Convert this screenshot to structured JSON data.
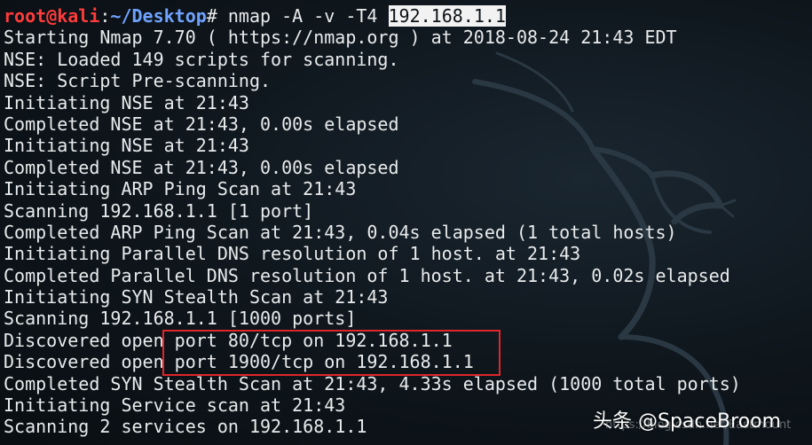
{
  "prompt": {
    "user_host": "root@kali",
    "separator": ":",
    "path": "~/Desktop",
    "symbol": "# ",
    "command": "nmap -A -v -T4 ",
    "target": "192.168.1.1"
  },
  "previous_line": "'' ' '  '  '",
  "output": [
    "Starting Nmap 7.70 ( https://nmap.org ) at 2018-08-24 21:43 EDT",
    "NSE: Loaded 149 scripts for scanning.",
    "NSE: Script Pre-scanning.",
    "Initiating NSE at 21:43",
    "Completed NSE at 21:43, 0.00s elapsed",
    "Initiating NSE at 21:43",
    "Completed NSE at 21:43, 0.00s elapsed",
    "Initiating ARP Ping Scan at 21:43",
    "Scanning 192.168.1.1 [1 port]",
    "Completed ARP Ping Scan at 21:43, 0.04s elapsed (1 total hosts)",
    "Initiating Parallel DNS resolution of 1 host. at 21:43",
    "Completed Parallel DNS resolution of 1 host. at 21:43, 0.02s elapsed",
    "Initiating SYN Stealth Scan at 21:43",
    "Scanning 192.168.1.1 [1000 ports]",
    "Discovered open port 80/tcp on 192.168.1.1",
    "Discovered open port 1900/tcp on 192.168.1.1",
    "Completed SYN Stealth Scan at 21:43, 4.33s elapsed (1000 total ports)",
    "Initiating Service scan at 21:43",
    "Scanning 2 services on 192.168.1.1"
  ],
  "watermark": {
    "url": "https://blog.csdn.net/Eastmount",
    "brand": "头条 @SpaceBroom"
  },
  "colors": {
    "background": "#0e151b",
    "text": "#e8ebec",
    "prompt_user": "#ff3b3b",
    "prompt_path": "#6fa3ff",
    "highlight_box": "#e0262b"
  }
}
